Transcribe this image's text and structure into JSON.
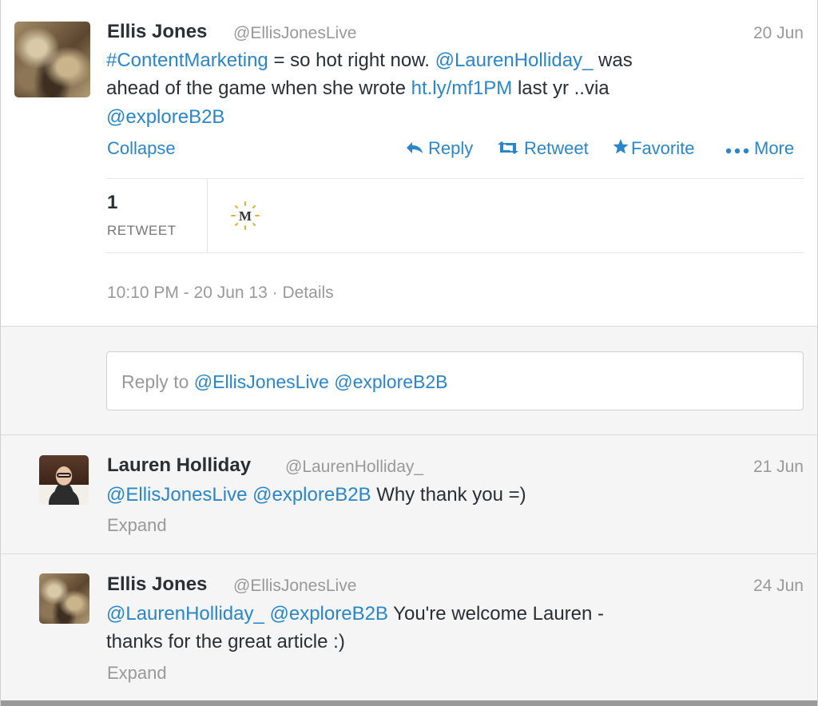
{
  "main_tweet": {
    "name": "Ellis Jones",
    "handle": "@EllisJonesLive",
    "date": "20 Jun",
    "line1": {
      "hashtag": "#ContentMarketing",
      "t1": " = so hot right now. ",
      "mention": "@LaurenHolliday_",
      "t2": " was"
    },
    "line2": {
      "t1": "ahead of the game when she wrote ",
      "link": "ht.ly/mf1PM",
      "t2": " last yr ..via"
    },
    "line3": {
      "mention": "@exploreB2B"
    },
    "actions": {
      "collapse": "Collapse",
      "reply": "Reply",
      "retweet": "Retweet",
      "favorite": "Favorite",
      "more": "More"
    },
    "stats": {
      "count": "1",
      "label": "RETWEET"
    },
    "meta": "10:10 PM - 20 Jun 13 · Details"
  },
  "reply_box": {
    "prefix": "Reply to ",
    "mentions": "@EllisJonesLive @exploreB2B"
  },
  "replies": [
    {
      "name": "Lauren Holliday",
      "handle": "@LaurenHolliday_",
      "date": "21 Jun",
      "mention1": "@EllisJonesLive",
      "mention2": "@exploreB2B",
      "text": " Why thank you =)",
      "expand": "Expand"
    },
    {
      "name": "Ellis Jones",
      "handle": "@EllisJonesLive",
      "date": "24 Jun",
      "mention1": "@LaurenHolliday_",
      "mention2": "@exploreB2B",
      "text": " You're welcome Lauren -",
      "line2": "thanks for the great article :)",
      "expand": "Expand"
    }
  ],
  "icons": {
    "reply": "reply-arrow-icon",
    "retweet": "retweet-icon",
    "favorite": "star-icon",
    "more": "dots-icon",
    "app": "m-logo-icon"
  },
  "colors": {
    "link": "#2a86c9",
    "muted": "#999999",
    "text": "#292f33",
    "panel": "#f5f5f5"
  }
}
